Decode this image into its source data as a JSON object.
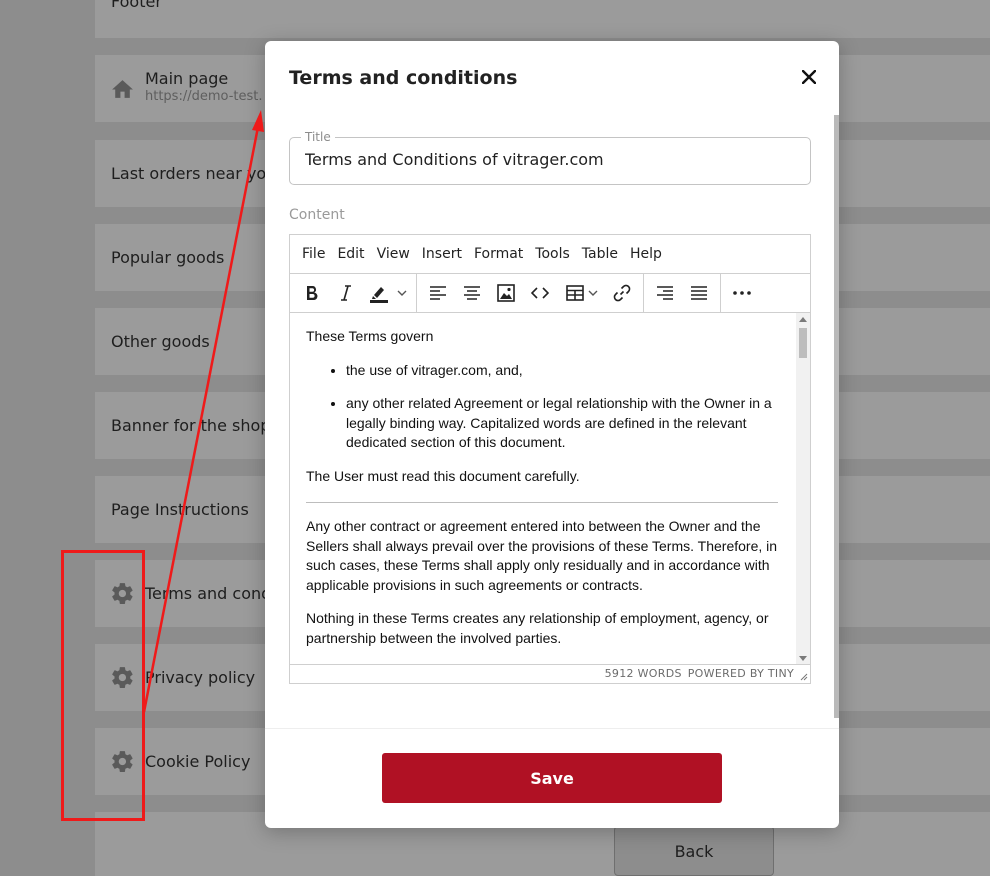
{
  "background": {
    "cards": {
      "footer": "Footer",
      "main_page_title": "Main page",
      "main_page_url": "https://demo-test.",
      "last_orders": "Last orders near you",
      "popular_goods": "Popular goods",
      "other_goods": "Other goods",
      "banner": "Banner for the shopp",
      "page_instructions": "Page Instructions",
      "terms": "Terms and condi",
      "privacy": "Privacy policy",
      "cookie": "Cookie Policy"
    },
    "back_label": "Back"
  },
  "modal": {
    "title": "Terms and conditions",
    "title_field": {
      "legend": "Title",
      "value": "Terms and Conditions of vitrager.com"
    },
    "content_label": "Content",
    "editor": {
      "menu": [
        "File",
        "Edit",
        "View",
        "Insert",
        "Format",
        "Tools",
        "Table",
        "Help"
      ],
      "body": {
        "intro": "These Terms govern",
        "bullets": [
          "the use of vitrager.com, and,",
          "any other related Agreement or legal relationship with the Owner in a legally binding way. Capitalized words are defined in the relevant dedicated section of this document."
        ],
        "p_read": "The User must read this document carefully.",
        "p_contract": "Any other contract or agreement entered into between the Owner and the Sellers shall always prevail over the provisions of these Terms. Therefore, in such cases, these Terms shall apply only residually and in accordance with applicable provisions in such agreements or contracts.",
        "p_nothing": "Nothing in these Terms creates any relationship of employment, agency, or partnership between the involved parties."
      },
      "word_count": "5912 WORDS",
      "powered_by": "POWERED BY TINY"
    },
    "save_label": "Save"
  },
  "colors": {
    "accent": "#b01124",
    "annotation": "#ef1a1a",
    "overlay_bg": "#8d8d8d"
  }
}
